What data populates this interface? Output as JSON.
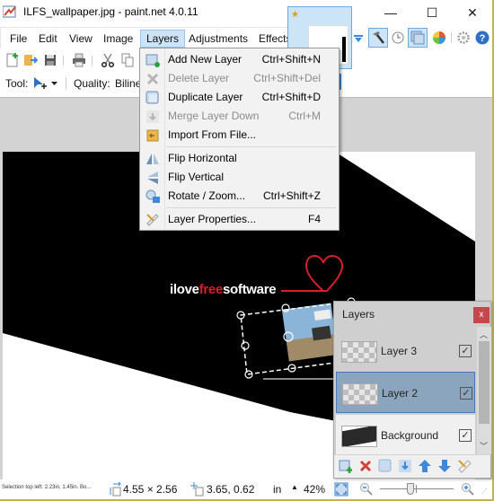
{
  "window": {
    "title": "ILFS_wallpaper.jpg - paint.net 4.0.11",
    "controls": {
      "minimize": "—",
      "maximize": "☐",
      "close": "✕"
    }
  },
  "menubar": {
    "items": [
      {
        "label": "File"
      },
      {
        "label": "Edit"
      },
      {
        "label": "View"
      },
      {
        "label": "Image"
      },
      {
        "label": "Layers",
        "active": true
      },
      {
        "label": "Adjustments"
      },
      {
        "label": "Effects"
      }
    ]
  },
  "toolbar": {
    "tool_label": "Tool:",
    "quality_label": "Quality:",
    "quality_value": "Biline",
    "icons": [
      "new-file-icon",
      "open-file-icon",
      "save-icon",
      "print-icon",
      "cut-icon",
      "copy-icon"
    ],
    "right_icons": [
      "dropdown-arrow-icon",
      "tools-hammer-icon",
      "history-clock-icon",
      "layers-window-icon",
      "colors-icon",
      "settings-gear-icon",
      "help-icon"
    ]
  },
  "layers_menu": {
    "items": [
      {
        "label": "Add New Layer",
        "shortcut": "Ctrl+Shift+N",
        "icon": "add-layer-icon",
        "disabled": false
      },
      {
        "label": "Delete Layer",
        "shortcut": "Ctrl+Shift+Del",
        "icon": "delete-layer-icon",
        "disabled": true
      },
      {
        "label": "Duplicate Layer",
        "shortcut": "Ctrl+Shift+D",
        "icon": "duplicate-layer-icon",
        "disabled": false
      },
      {
        "label": "Merge Layer Down",
        "shortcut": "Ctrl+M",
        "icon": "merge-layer-down-icon",
        "disabled": true
      },
      {
        "label": "Import From File...",
        "shortcut": "",
        "icon": "import-file-icon",
        "disabled": false
      },
      {
        "label": "Flip Horizontal",
        "shortcut": "",
        "icon": "flip-horizontal-icon",
        "disabled": false
      },
      {
        "label": "Flip Vertical",
        "shortcut": "",
        "icon": "flip-vertical-icon",
        "disabled": false
      },
      {
        "label": "Rotate / Zoom...",
        "shortcut": "Ctrl+Shift+Z",
        "icon": "rotate-zoom-icon",
        "disabled": false
      },
      {
        "label": "Layer Properties...",
        "shortcut": "F4",
        "icon": "layer-properties-icon",
        "disabled": false
      }
    ]
  },
  "canvas": {
    "logo_text_part1": "ilove",
    "logo_text_part2": "free",
    "logo_text_part3": "software"
  },
  "layers_panel": {
    "title": "Layers",
    "close": "x",
    "layers": [
      {
        "name": "Layer 3",
        "visible": true,
        "selected": false
      },
      {
        "name": "Layer 2",
        "visible": true,
        "selected": true
      },
      {
        "name": "Background",
        "visible": true,
        "selected": false
      }
    ],
    "buttons": [
      "add-layer",
      "delete-layer",
      "duplicate-layer",
      "merge-down",
      "move-up",
      "move-down",
      "properties"
    ]
  },
  "statusbar": {
    "selection_info": "Selection top left: 2.23in, 1.45in. Bo...",
    "selection_size": "4.55 × 2.56",
    "cursor_pos": "3.65, 0.62",
    "units": "in",
    "zoom": "42%",
    "zoom_slider_fraction": 0.42
  },
  "colors": {
    "accent": "#cce4f7",
    "logo_red": "#d3202a",
    "panel_close": "#c4474d",
    "selected_layer": "#8ba5bf"
  }
}
